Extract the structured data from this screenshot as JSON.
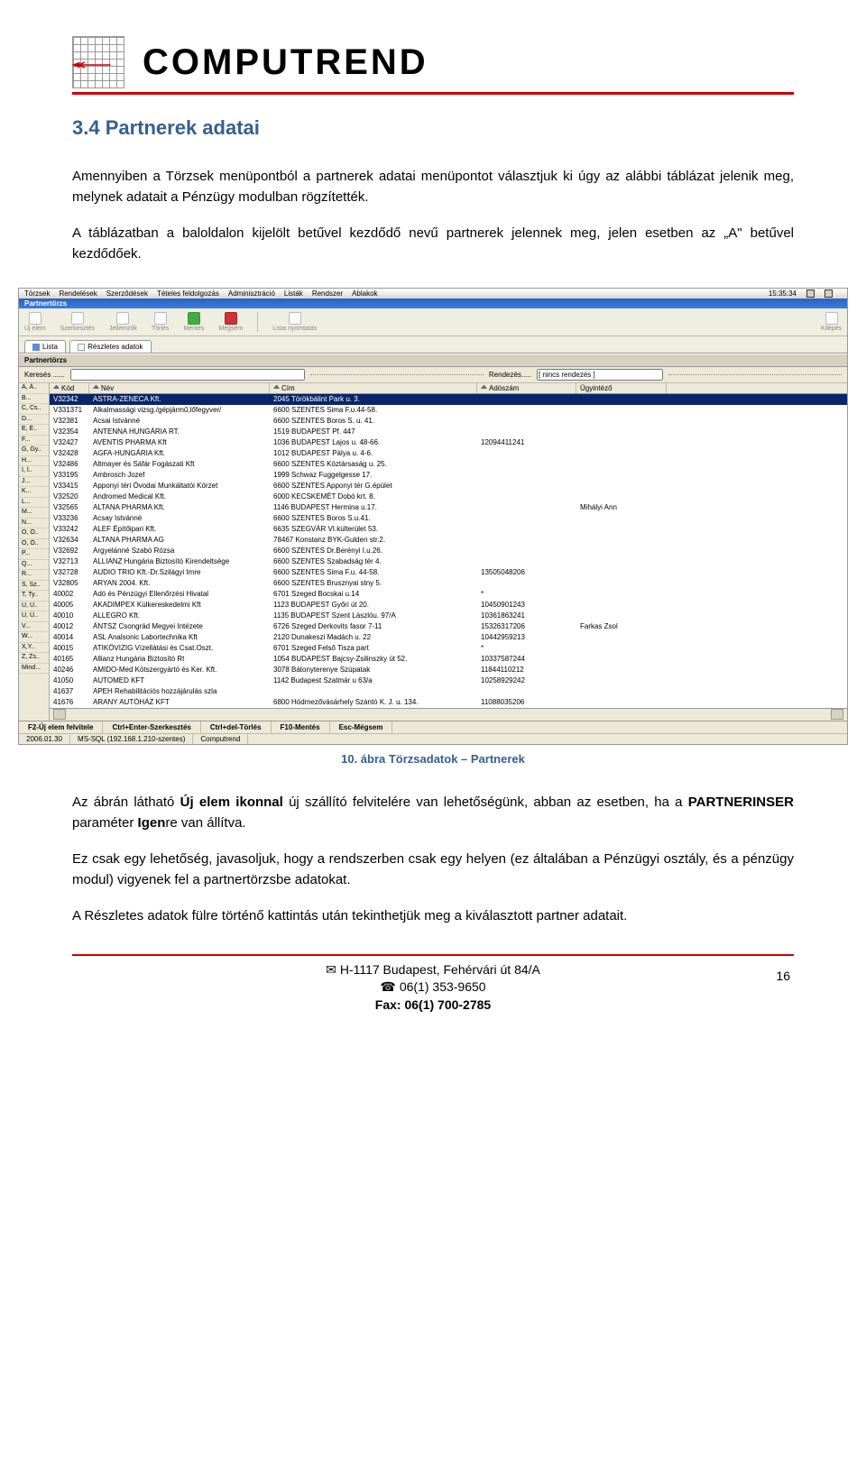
{
  "company_name": "COMPUTREND",
  "section": {
    "heading": "3.4  Partnerek adatai",
    "para1": "Amennyiben a Törzsek menüpontból a partnerek adatai menüpontot választjuk ki úgy az alábbi táblázat jelenik meg, melynek adatait a Pénzügy modulban rögzítették.",
    "para2": "A táblázatban a baloldalon kijelölt betűvel kezdődő nevű partnerek jelennek meg, jelen esetben az „A\" betűvel kezdődőek.",
    "figcaption": "10. ábra Törzsadatok – Partnerek",
    "para3_a": "Az ábrán látható ",
    "para3_b": "Új elem ikonnal",
    "para3_c": " új szállító felvitelére van lehetőségünk, abban az esetben, ha a ",
    "para3_d": "PARTNERINSER",
    "para3_e": " paraméter ",
    "para3_f": "Igen",
    "para3_g": "re van állítva.",
    "para4": "Ez csak egy lehetőség, javasoljuk, hogy a rendszerben csak egy helyen (ez általában a Pénzügyi osztály, és a pénzügy modul) vigyenek fel a partnertörzsbe adatokat.",
    "para5": "A Részletes adatok fülre történő kattintás után tekinthetjük meg a kiválasztott partner adatait."
  },
  "app": {
    "menus": [
      "Törzsek",
      "Rendelések",
      "Szerződések",
      "Tételes feldolgozás",
      "Adminisztráció",
      "Listák",
      "Rendszer",
      "Ablakok"
    ],
    "time": "15:35:34",
    "window_title": "Partnertörzs",
    "toolbar": [
      "Új elem",
      "Szerkesztés",
      "Jellemzők",
      "Törlés",
      "Mentés",
      "Mégsem",
      "Lista nyomtatás",
      "Kilépés"
    ],
    "tabs": [
      "Lista",
      "Részletes adatok"
    ],
    "panel_title": "Partnertörzs",
    "search_label": "Keresés ......",
    "sort_label": "Rendezés.....",
    "sort_value": "[ nincs rendezés ]",
    "alpha": [
      "A, Á..",
      "B...",
      "C, Cs..",
      "D...",
      "E, É..",
      "F...",
      "G, Gy..",
      "H...",
      "I, Í..",
      "J...",
      "K...",
      "L...",
      "M...",
      "N...",
      "O, Ó..",
      "Ö, Ő..",
      "P...",
      "Q...",
      "R...",
      "S, Sz..",
      "T, Ty..",
      "U, Ú..",
      "Ü, Ű..",
      "V...",
      "W...",
      "X,Y..",
      "Z, Zs..",
      "Mind..."
    ],
    "columns": [
      "Kód",
      "Név",
      "Cím",
      "Adószám",
      "Ügyintéző"
    ],
    "rows": [
      {
        "kod": "V32342",
        "nev": "ASTRA-ZENECA Kft.",
        "cim": "2045 Törökbálint Park u. 3.",
        "ado": "",
        "ugy": "",
        "sel": true
      },
      {
        "kod": "V331371",
        "nev": "Alkalmassági vizsg./gépjármű,lőfegyver/",
        "cim": "6600 SZENTES Sima F.u.44-58.",
        "ado": "",
        "ugy": ""
      },
      {
        "kod": "V32381",
        "nev": "Acsai Istvánné",
        "cim": "6600 SZENTES Boros S. u. 41.",
        "ado": "",
        "ugy": ""
      },
      {
        "kod": "V32354",
        "nev": "ANTENNA HUNGÁRIA RT.",
        "cim": "1519 BUDAPEST Pf. 447",
        "ado": "",
        "ugy": ""
      },
      {
        "kod": "V32427",
        "nev": "AVENTIS PHARMA Kft",
        "cim": "1036 BUDAPEST Lajos u. 48-66.",
        "ado": "12094411241",
        "ugy": ""
      },
      {
        "kod": "V32428",
        "nev": "AGFA-HUNGÁRIA Kft.",
        "cim": "1012 BUDAPEST Pálya u. 4-6.",
        "ado": "",
        "ugy": ""
      },
      {
        "kod": "V32486",
        "nev": "Altmayer és Sáfár Fogászati Kft",
        "cim": "6600 SZENTES Köztársaság u. 25.",
        "ado": "",
        "ugy": ""
      },
      {
        "kod": "V33195",
        "nev": "Ambrosch Jozef",
        "cim": "1999 Schwaz Fuggelgesse 17.",
        "ado": "",
        "ugy": ""
      },
      {
        "kod": "V33415",
        "nev": "Apponyi téri Óvodai Munkáltatói Körzet",
        "cim": "6600 SZENTES Apponyi tér G.épület",
        "ado": "",
        "ugy": ""
      },
      {
        "kod": "V32520",
        "nev": "Andromed Medical Kft.",
        "cim": "6000 KECSKEMÉT Dobó krt. 8.",
        "ado": "",
        "ugy": ""
      },
      {
        "kod": "V32565",
        "nev": "ALTANA PHARMA Kft.",
        "cim": "1146 BUDAPEST Hermina u.17.",
        "ado": "",
        "ugy": "Mihályi Ann"
      },
      {
        "kod": "V33236",
        "nev": "Acsay Istvánné",
        "cim": "6600 SZENTES Boros S.u.41.",
        "ado": "",
        "ugy": ""
      },
      {
        "kod": "V33242",
        "nev": "ALEF Építőipari Kft.",
        "cim": "6635 SZEGVÁR VI.külterület 53.",
        "ado": "",
        "ugy": ""
      },
      {
        "kod": "V32634",
        "nev": "ALTANA PHARMA AG",
        "cim": "78467 Konstanz BYK-Gulden str.2.",
        "ado": "",
        "ugy": ""
      },
      {
        "kod": "V32692",
        "nev": "Argyelánné Szabó Rózsa",
        "cim": "6600 SZENTES Dr.Berényi I.u.26.",
        "ado": "",
        "ugy": ""
      },
      {
        "kod": "V32713",
        "nev": "ALLIANZ Hungária Biztosító Kirendeltsége",
        "cim": "6600 SZENTES Szabadság tér 4.",
        "ado": "",
        "ugy": ""
      },
      {
        "kod": "V32728",
        "nev": "AUDIO TRIO Kft.-Dr.Szilágyi Imre",
        "cim": "6600 SZENTES Sima F.u. 44-58.",
        "ado": "13505048206",
        "ugy": ""
      },
      {
        "kod": "V32805",
        "nev": "ARYAN 2004. Kft.",
        "cim": "6600 SZENTES Brusznyai stny 5.",
        "ado": "",
        "ugy": ""
      },
      {
        "kod": "40002",
        "nev": "Adó és Pénzügyi Ellenőrzési Hivatal",
        "cim": "6701 Szeged Bocskai u.14",
        "ado": "*",
        "ugy": ""
      },
      {
        "kod": "40005",
        "nev": "AKADIMPEX Külkereskedelmi Kft",
        "cim": "1123 BUDAPEST Győri út 20.",
        "ado": "10450901243",
        "ugy": ""
      },
      {
        "kod": "40010",
        "nev": "ALLEGRO Kft.",
        "cim": "1135 BUDAPEST Szent Lászlóu. 97/A",
        "ado": "10361863241",
        "ugy": ""
      },
      {
        "kod": "40012",
        "nev": "ÁNTSZ Csongrád Megyei Intézete",
        "cim": "6726 Szeged Derkovits fasor 7-11",
        "ado": "15326317206",
        "ugy": "Farkas Zsol"
      },
      {
        "kod": "40014",
        "nev": "ASL Analsonic Labortechnika Kft",
        "cim": "2120 Dunakeszi Madách u. 22",
        "ado": "10442959213",
        "ugy": ""
      },
      {
        "kod": "40015",
        "nev": "ATIKÖVIZIG Vízellátási és Csat.Oszt.",
        "cim": "6701 Szeged Felső Tisza part",
        "ado": "*",
        "ugy": ""
      },
      {
        "kod": "40165",
        "nev": "Allianz Hungária Biztosító Rt",
        "cim": "1054 BUDAPEST Bajcsy-Zsilinszky út 52.",
        "ado": "10337587244",
        "ugy": ""
      },
      {
        "kod": "40246",
        "nev": "AMIDO-Med Kötszergyártó és Ker. Kft.",
        "cim": "3078 Bátonyterenye Szúpatak",
        "ado": "11844110212",
        "ugy": ""
      },
      {
        "kod": "41050",
        "nev": "AUTOMED KFT",
        "cim": "1142 Budapest Szatmár u 63/a",
        "ado": "10258929242",
        "ugy": ""
      },
      {
        "kod": "41637",
        "nev": "APEH Rehabilitációs hozzájárulás szla",
        "cim": "",
        "ado": "",
        "ugy": ""
      },
      {
        "kod": "41676",
        "nev": "ARANY AUTÓHÁZ KFT",
        "cim": "6800 Hódmezővásárhely Szántó K. J. u. 134.",
        "ado": "11088035206",
        "ugy": ""
      }
    ],
    "shortcuts": [
      "F2-Új elem felvitele",
      "Ctrl+Enter-Szerkesztés",
      "Ctrl+del-Törlés",
      "F10-Mentés",
      "Esc-Mégsem"
    ],
    "status": [
      "2006.01.30",
      "MS-SQL (192.168.1.210-szentes)",
      "Computrend"
    ]
  },
  "footer": {
    "address": "H-1117 Budapest, Fehérvári út 84/A",
    "phone": "06(1) 353-9650",
    "fax": "Fax: 06(1) 700-2785",
    "page_num": "16"
  }
}
